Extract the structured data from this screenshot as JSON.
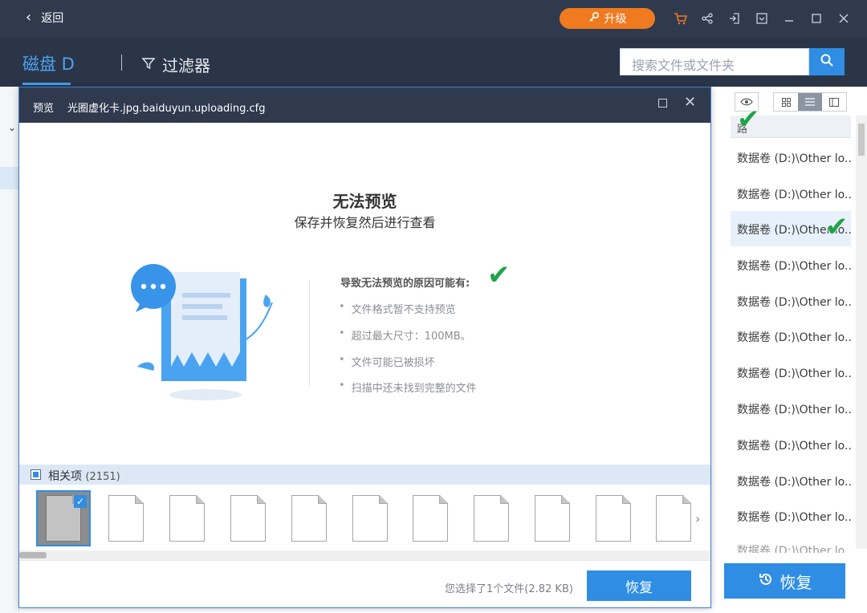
{
  "topbar": {
    "back_label": "返回",
    "upgrade_label": "升级",
    "accent": "#f07a1f"
  },
  "header": {
    "drive_label": "磁盘 D",
    "filter_label": "过滤器",
    "search_placeholder": "搜索文件或文件夹"
  },
  "file_list": {
    "column_header": "路",
    "rows": [
      "数据卷 (D:)\\Other lo...",
      "数据卷 (D:)\\Other lo...",
      "数据卷 (D:)\\Other lo...",
      "数据卷 (D:)\\Other lo...",
      "数据卷 (D:)\\Other lo...",
      "数据卷 (D:)\\Other lo...",
      "数据卷 (D:)\\Other lo...",
      "数据卷 (D:)\\Other lo...",
      "数据卷 (D:)\\Other lo...",
      "数据卷 (D:)\\Other lo...",
      "数据卷 (D:)\\Other lo..."
    ],
    "recover_label": "恢复"
  },
  "preview": {
    "title_label": "预览",
    "file_name": "光圈虚化卡.jpg.baiduyun.uploading.cfg",
    "heading": "无法预览",
    "subheading": "保存并恢复然后进行查看",
    "reasons_title": "导致无法预览的原因可能有:",
    "reasons": [
      "文件格式暂不支持预览",
      "超过最大尺寸：100MB。",
      "文件可能已被损坏",
      "扫描中还未找到完整的文件"
    ],
    "related_label": "相关项",
    "related_count": "(2151)",
    "selection_info": "您选择了1个文件(2.82 KB)",
    "recover_label": "恢复"
  },
  "colors": {
    "primary": "#2f8de4",
    "title_bar": "#2f3a4f",
    "check_mark": "#21a34a"
  }
}
